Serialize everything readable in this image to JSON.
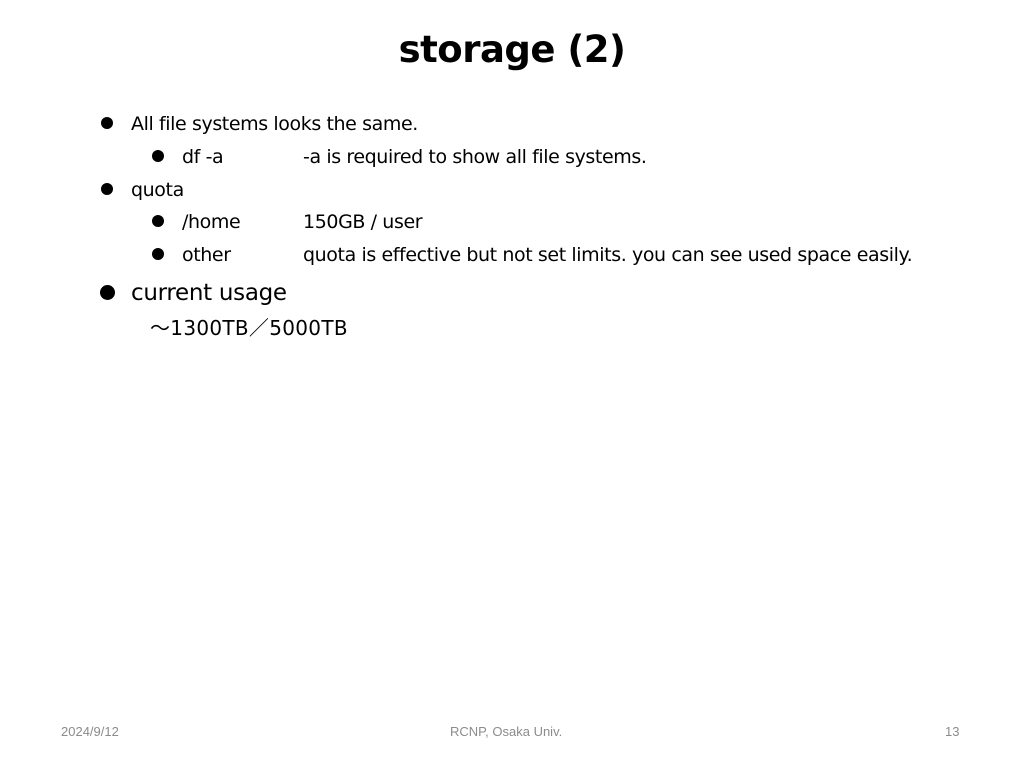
{
  "slide": {
    "title": "storage (2)",
    "bullets": [
      {
        "text": "All file systems looks the same.",
        "children": [
          {
            "label": "df -a",
            "description": "-a is required to show all file systems."
          }
        ]
      },
      {
        "text": "quota",
        "children": [
          {
            "label": "/home",
            "description": "150GB / user"
          },
          {
            "label": "other",
            "description": "quota is effective but not set limits. you can see used space easily."
          }
        ]
      },
      {
        "text": "current usage",
        "detail": "～1300TB／5000TB"
      }
    ]
  },
  "footer": {
    "date": "2024/9/12",
    "center": "RCNP, Osaka Univ.",
    "page_number": "13"
  }
}
